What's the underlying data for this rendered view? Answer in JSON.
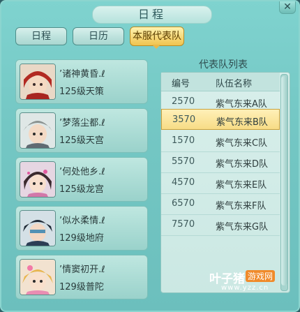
{
  "window": {
    "title": "日程",
    "close_icon": "close-icon"
  },
  "tabs": [
    {
      "label": "日程",
      "active": false
    },
    {
      "label": "日历",
      "active": false
    },
    {
      "label": "本服代表队",
      "active": true
    }
  ],
  "members": [
    {
      "name": "’诸神黄昏.ℓ",
      "level": "125级天策",
      "avatar": "avatar-red-hair-girl"
    },
    {
      "name": "’梦落尘都.ℓ",
      "level": "125级天宫",
      "avatar": "avatar-gray-hair-boy"
    },
    {
      "name": "’何处他乡.ℓ",
      "level": "125级龙宫",
      "avatar": "avatar-flower-girl"
    },
    {
      "name": "’似水柔情.ℓ",
      "level": "129级地府",
      "avatar": "avatar-dark-hair-boy"
    },
    {
      "name": "’情窦初开.ℓ",
      "level": "129级普陀",
      "avatar": "avatar-blonde-girl"
    }
  ],
  "team_list": {
    "title": "代表队列表",
    "headers": {
      "code": "编号",
      "name": "队伍名称"
    },
    "rows": [
      {
        "code": "2570",
        "name": "紫气东来A队",
        "selected": false
      },
      {
        "code": "3570",
        "name": "紫气东来B队",
        "selected": true
      },
      {
        "code": "1570",
        "name": "紫气东来C队",
        "selected": false
      },
      {
        "code": "5570",
        "name": "紫气东来D队",
        "selected": false
      },
      {
        "code": "4570",
        "name": "紫气东来E队",
        "selected": false
      },
      {
        "code": "6570",
        "name": "紫气东来F队",
        "selected": false
      },
      {
        "code": "7570",
        "name": "紫气东来G队",
        "selected": false
      }
    ]
  },
  "watermark": {
    "brand": "叶子猪",
    "tag": "游戏网",
    "url": "www.yzz.cn"
  },
  "colors": {
    "selected_row": "#f7dc86",
    "active_tab": "#f0c34e",
    "panel": "#74c7c4"
  }
}
